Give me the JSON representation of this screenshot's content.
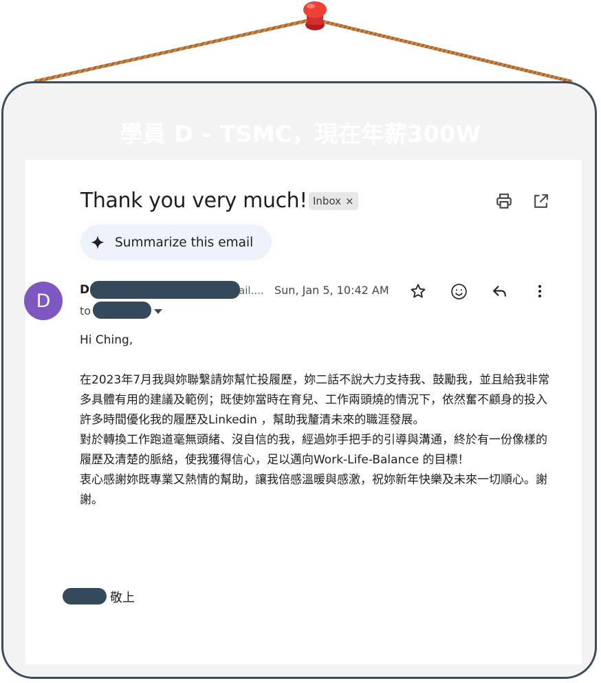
{
  "header": {
    "title": "學員 D - TSMC，現在年薪300W"
  },
  "email": {
    "subject": "Thank you very much!",
    "label": "Inbox",
    "label_remove": "×",
    "summarize_label": "Summarize this email",
    "sender_initial": "D",
    "avatar_letter": "D",
    "sender_tail": "ail....",
    "date": "Sun, Jan 5, 10:42 AM",
    "to_label": "to",
    "greeting": "Hi Ching,",
    "paragraphs": [
      "在2023年7月我與妳聯繫請妳幫忙投履歷，妳二話不說大力支持我、鼓勵我，並且給我非常多具體有用的建議及範例；既使妳當時在育兒、工作兩頭燒的情況下，依然奮不顧身的投入許多時間優化我的履歷及Linkedin ，幫助我釐清未來的職涯發展。",
      "對於轉換工作跑道毫無頭緒、沒自信的我，經過妳手把手的引導與溝通，終於有一份像樣的履歷及清楚的脈絡，使我獲得信心，足以邁向Work-Life-Balance 的目標！",
      "衷心感謝妳既專業又熱情的幫助，讓我倍感溫暖與感激，祝妳新年快樂及未來一切順心。謝謝。"
    ],
    "signoff": "敬上"
  },
  "icons": {
    "print": "print-icon",
    "open_new": "open-in-new-icon",
    "spark": "sparkle-icon",
    "star": "star-icon",
    "emoji": "emoji-icon",
    "reply": "reply-icon",
    "more": "more-vert-icon"
  },
  "colors": {
    "frame_border": "#3b4d5c",
    "frame_bg": "#f3f3f3",
    "avatar": "#7e57c2",
    "redaction": "#34495a",
    "pin": "#e53935",
    "rope": "#c07a3e"
  }
}
